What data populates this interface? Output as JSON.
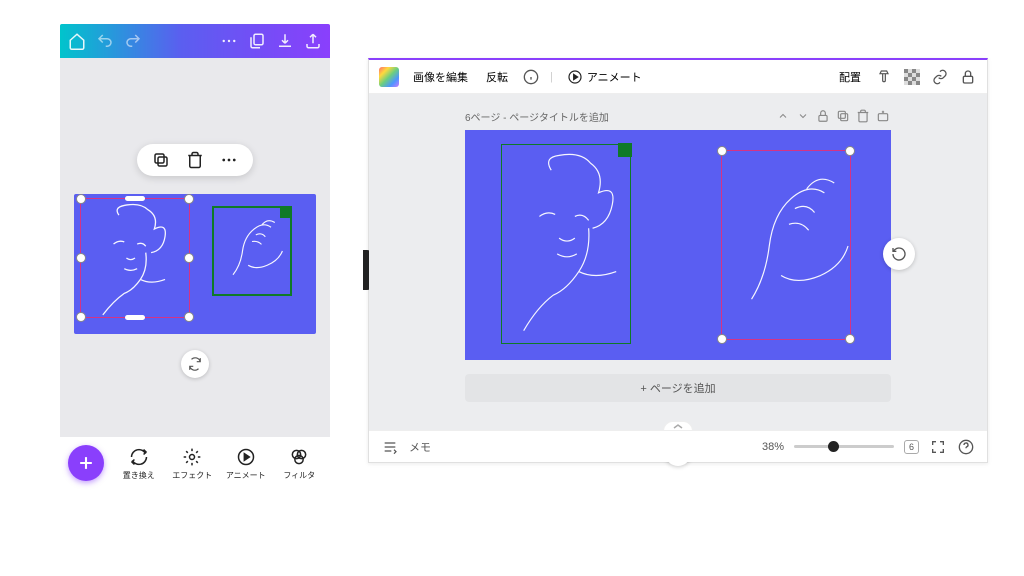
{
  "mobile": {
    "bottom": {
      "replace": "置き換え",
      "effect": "エフェクト",
      "animate": "アニメート",
      "filter": "フィルタ"
    }
  },
  "desktop": {
    "toolbar": {
      "edit_image": "画像を編集",
      "flip": "反転",
      "animate": "アニメート",
      "position": "配置"
    },
    "page": {
      "label": "6ページ - ページタイトルを追加"
    },
    "add_page": "+ ページを追加",
    "footer": {
      "memo": "メモ",
      "zoom": "38%",
      "pages": "6"
    }
  }
}
